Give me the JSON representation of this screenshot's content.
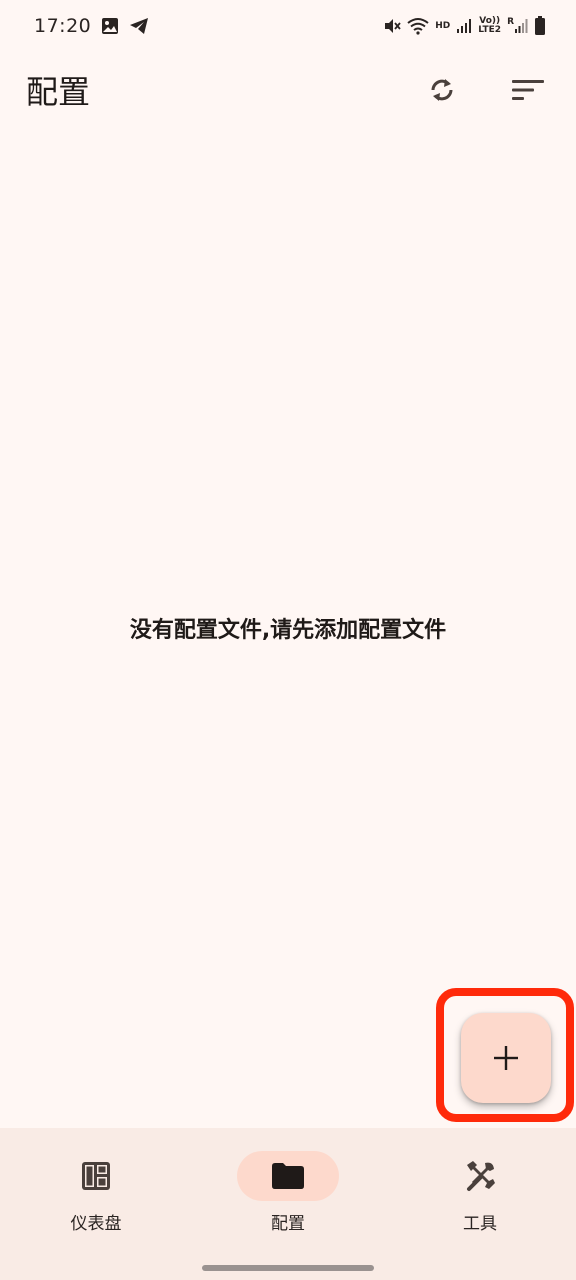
{
  "status_bar": {
    "time": "17:20",
    "left_icons": [
      "image-icon",
      "telegram-icon"
    ],
    "right_icons": [
      "mute-icon",
      "wifi-icon",
      "signal-icon",
      "signal-icon",
      "battery-icon"
    ],
    "hd_label": "HD",
    "volte_label": "Vo))",
    "lte_label": "LTE2",
    "roaming_label": "R"
  },
  "app_bar": {
    "title": "配置",
    "actions": [
      "sync-icon",
      "sort-icon"
    ]
  },
  "main": {
    "empty_message": "没有配置文件,请先添加配置文件"
  },
  "fab": {
    "icon": "plus-icon",
    "highlight_color": "#ff2a0a",
    "background": "#fdd9cc"
  },
  "bottom_nav": {
    "items": [
      {
        "label": "仪表盘",
        "icon": "dashboard-icon",
        "active": false
      },
      {
        "label": "配置",
        "icon": "folder-icon",
        "active": true
      },
      {
        "label": "工具",
        "icon": "tools-icon",
        "active": false
      }
    ]
  },
  "colors": {
    "background": "#fff7f4",
    "nav_background": "#f9ebe5",
    "accent": "#fdd9cc",
    "text": "#1f1a18"
  }
}
